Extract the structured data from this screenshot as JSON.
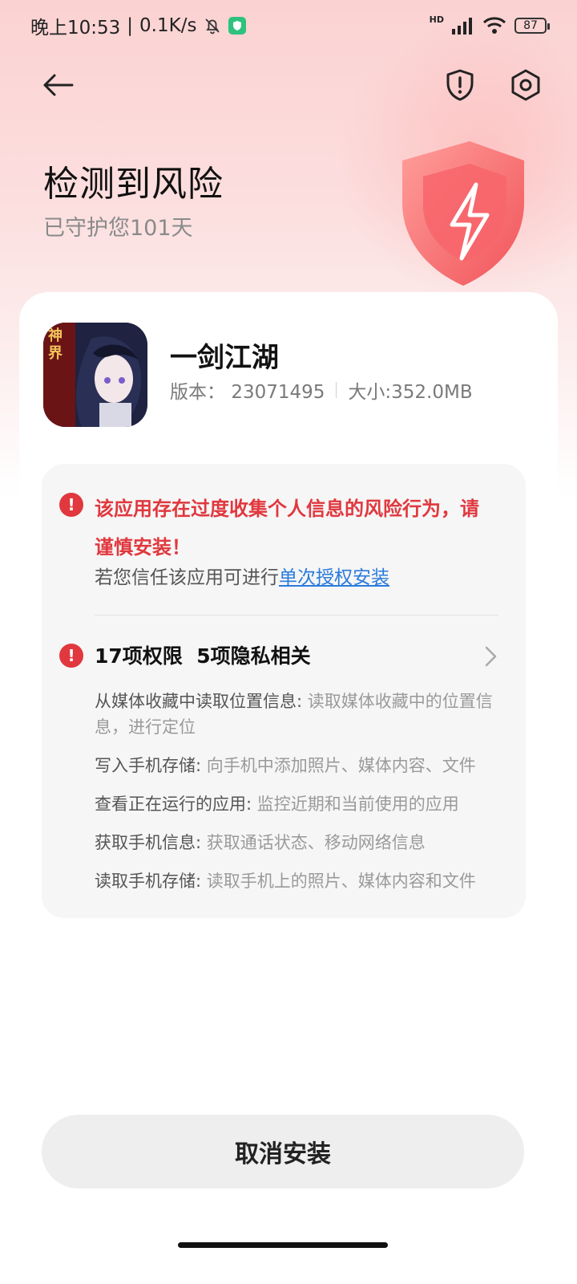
{
  "status_bar": {
    "time": "晚上10:53",
    "net_speed": "0.1K/s",
    "separator": "|",
    "network_type": "HD",
    "battery": "87"
  },
  "header": {
    "title": "检测到风险",
    "subtitle": "已守护您101天"
  },
  "app": {
    "name": "一剑江湖",
    "version_label": "版本：",
    "version": "23071495",
    "size_label": "大小:",
    "size": "352.0MB",
    "icon_text": "神界"
  },
  "warning": {
    "risk_message": "该应用存在过度收集个人信息的风险行为，请谨慎安装！",
    "trust_prefix": "若您信任该应用可进行",
    "trust_link": "单次授权安装"
  },
  "permissions": {
    "summary_count": "17项权限",
    "summary_privacy": "5项隐私相关",
    "items": [
      {
        "name": "从媒体收藏中读取位置信息: ",
        "desc": "读取媒体收藏中的位置信息，进行定位"
      },
      {
        "name": "写入手机存储: ",
        "desc": "向手机中添加照片、媒体内容、文件"
      },
      {
        "name": "查看正在运行的应用: ",
        "desc": "监控近期和当前使用的应用"
      },
      {
        "name": "获取手机信息: ",
        "desc": "获取通话状态、移动网络信息"
      },
      {
        "name": "读取手机存储: ",
        "desc": "读取手机上的照片、媒体内容和文件"
      }
    ]
  },
  "actions": {
    "cancel_label": "取消安装"
  },
  "colors": {
    "danger": "#e0383e",
    "link": "#2a7bdc",
    "header_bg": "#fbd2d2"
  }
}
